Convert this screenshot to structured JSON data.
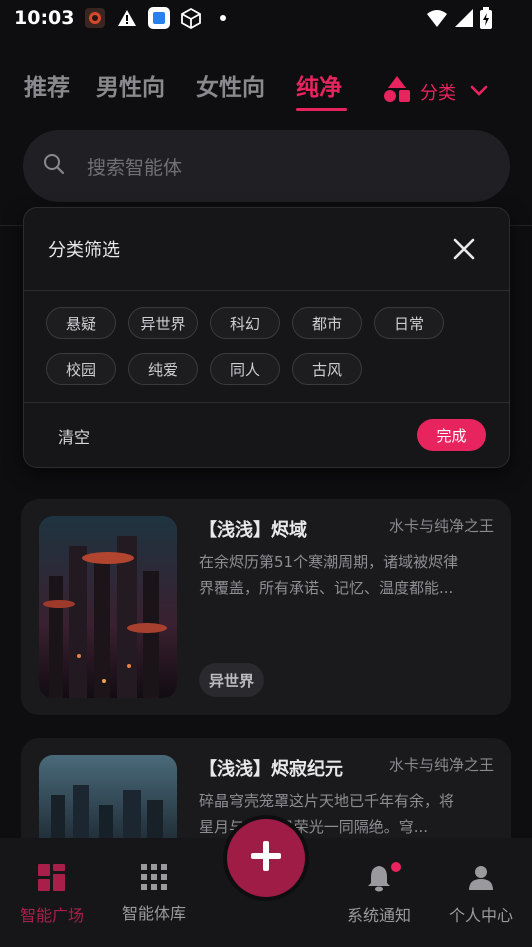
{
  "status_bar": {
    "time": "10:03"
  },
  "tabs": [
    {
      "label": "推荐"
    },
    {
      "label": "男性向"
    },
    {
      "label": "女性向"
    },
    {
      "label": "纯净"
    }
  ],
  "active_tab": "纯净",
  "category_button": {
    "label": "分类"
  },
  "search": {
    "placeholder": "搜索智能体"
  },
  "filter_popup": {
    "title": "分类筛选",
    "chips": [
      "悬疑",
      "异世界",
      "科幻",
      "都市",
      "日常",
      "校园",
      "纯爱",
      "同人",
      "古风"
    ],
    "clear_label": "清空",
    "done_label": "完成"
  },
  "cards": [
    {
      "title": "【浅浅】烬域",
      "author": "水卡与纯净之王",
      "desc_line1": "在余烬历第51个寒潮周期，诸域被烬律",
      "desc_line2": "界覆盖，所有承诺、记忆、温度都能...",
      "tag": "异世界"
    },
    {
      "title": "【浅浅】烬寂纪元",
      "author": "水卡与纯净之王",
      "desc_line1": "碎晶穹壳笼罩这片天地已千年有余，将",
      "desc_line2": "星月与   如旧日荣光一同隔绝。穹..."
    }
  ],
  "bottom_nav": [
    {
      "label": "智能广场",
      "icon": "square-grid-icon"
    },
    {
      "label": "智能体库",
      "icon": "dot-grid-icon"
    },
    {
      "label": "系统通知",
      "icon": "bell-icon"
    },
    {
      "label": "个人中心",
      "icon": "person-icon"
    }
  ],
  "colors": {
    "accent": "#e8245e",
    "background": "#0e0e10"
  }
}
